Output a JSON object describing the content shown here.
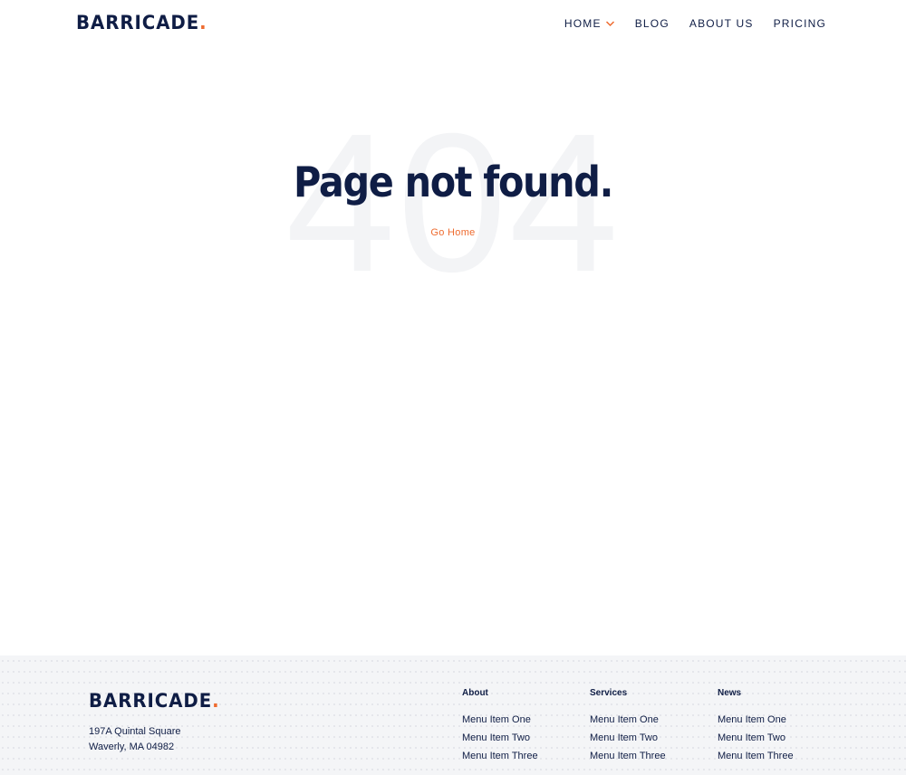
{
  "brand": {
    "name": "BARRICADE",
    "dot": "."
  },
  "nav": {
    "items": [
      {
        "label": "HOME",
        "has_dropdown": true
      },
      {
        "label": "BLOG"
      },
      {
        "label": "ABOUT US"
      },
      {
        "label": "PRICING"
      }
    ]
  },
  "hero": {
    "bg_number": "404",
    "title": "Page not found.",
    "link": "Go Home"
  },
  "footer": {
    "brand": {
      "name": "BARRICADE",
      "dot": "."
    },
    "address": {
      "line1": "197A Quintal Square",
      "line2": "Waverly, MA 04982"
    },
    "columns": [
      {
        "heading": "About",
        "items": [
          "Menu Item One",
          "Menu Item Two",
          "Menu Item Three"
        ]
      },
      {
        "heading": "Services",
        "items": [
          "Menu Item One",
          "Menu Item Two",
          "Menu Item Three"
        ]
      },
      {
        "heading": "News",
        "items": [
          "Menu Item One",
          "Menu Item Two",
          "Menu Item Three"
        ]
      }
    ]
  },
  "colors": {
    "navy": "#0f1d45",
    "accent": "#ee6b2f",
    "footer_bg": "#f4f5f7",
    "bg_number": "#f3f4f6"
  },
  "icons": {
    "dropdown": "chevron-down-icon"
  }
}
